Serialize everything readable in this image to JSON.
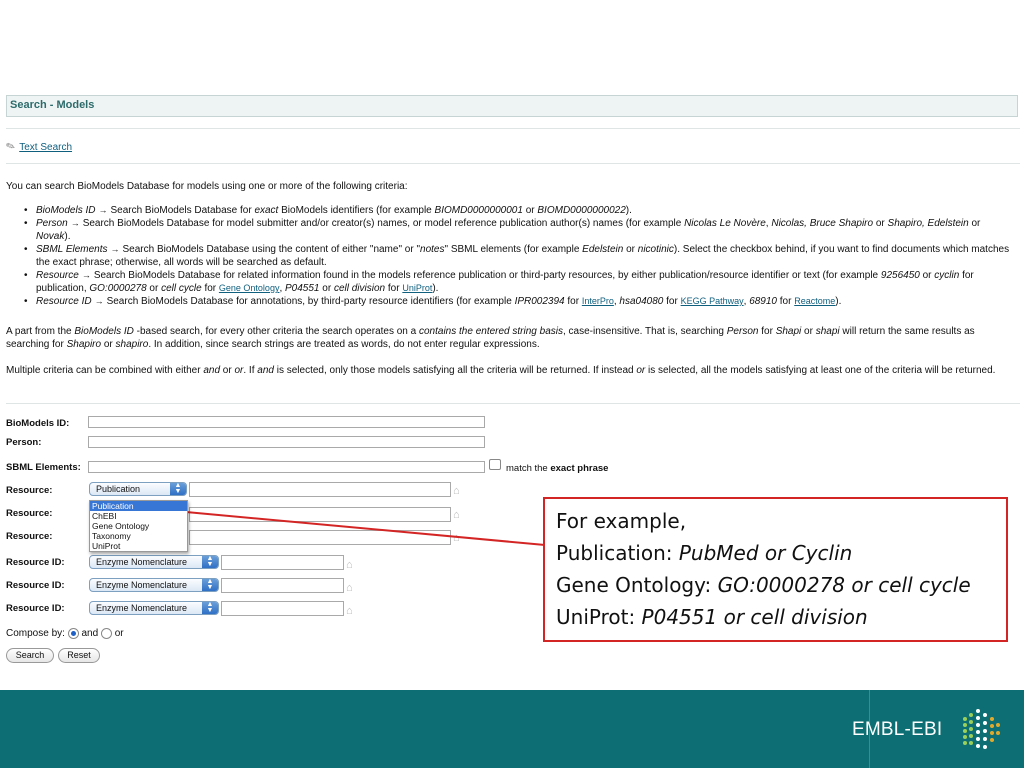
{
  "header": {
    "title": "Search - Models"
  },
  "text_search": {
    "label": "Text Search"
  },
  "intro": "You can search BioModels Database for models using one or more of the following criteria:",
  "criteria": [
    {
      "name": "BioModels ID",
      "arrow": "→"
    },
    {
      "name": "Person",
      "arrow": "→"
    },
    {
      "name": "SBML Elements",
      "arrow": "→"
    },
    {
      "name": "Resource",
      "arrow": "→"
    },
    {
      "name": "Resource ID",
      "arrow": "→"
    }
  ],
  "text": {
    "c1a": "Search BioModels Database for ",
    "c1b": "exact",
    "c1c": " BioModels identifiers (for example ",
    "c1d": "BIOMD0000000001",
    "c1e": " or ",
    "c1f": "BIOMD0000000022",
    "c1g": ").",
    "c2a": "Search BioModels Database for model submitter and/or creator(s) names, or model reference publication author(s) names (for example ",
    "c2b": "Nicolas Le Novère",
    "c2c": ", ",
    "c2d": "Nicolas, Bruce Shapiro",
    "c2e": " or ",
    "c2f": "Shapiro, Edelstein",
    "c2g": " or ",
    "c2h": "Novak",
    "c2i": ").",
    "c3a": "Search BioModels Database using the content of either \"name\" or \"",
    "c3b": "notes",
    "c3c": "\" SBML elements (for example ",
    "c3d": "Edelstein",
    "c3e": " or ",
    "c3f": "nicotinic",
    "c3g": "). Select the checkbox behind, if you want to find documents which matches the exact phrase; otherwise, all words will be searched as default.",
    "c4a": "Search BioModels Database for related information found in the models reference publication or third-party resources, by either publication/resource identifier or text (for example ",
    "c4b": "9256450",
    "c4c": " or ",
    "c4d": "cyclin",
    "c4e": " for publication, ",
    "c4f": "GO:0000278",
    "c4g": " or ",
    "c4h": "cell cycle",
    "c4i": " for ",
    "c4j": "Gene Ontology",
    "c4k": ", ",
    "c4l": "P04551",
    "c4m": " or ",
    "c4n": "cell division",
    "c4o": " for ",
    "c4p": "UniProt",
    "c4q": ").",
    "c5a": "Search BioModels Database for annotations, by third-party resource identifiers (for example ",
    "c5b": "IPR002394",
    "c5c": " for ",
    "c5d": "InterPro",
    "c5e": ", ",
    "c5f": "hsa04080",
    "c5g": " for ",
    "c5h": "KEGG Pathway",
    "c5i": ", ",
    "c5j": "68910",
    "c5k": " for ",
    "c5l": "Reactome",
    "c5m": ").",
    "p1a": "A part from the ",
    "p1b": "BioModels ID",
    "p1c": " -based search, for every other criteria the search operates on a ",
    "p1d": "contains the entered string basis",
    "p1e": ", case-insensitive. That is, searching ",
    "p1f": "Person",
    "p1g": " for ",
    "p1h": "Shapi",
    "p1i": " or ",
    "p1j": "shapi",
    "p1k": " will return the same results as searching for ",
    "p1l": "Shapiro",
    "p1m": " or ",
    "p1n": "shapiro",
    "p1o": ". In addition, since search strings are treated as words, do not enter regular expressions.",
    "p2a": "Multiple criteria can be combined with either ",
    "p2b": "and",
    "p2c": " or ",
    "p2d": "or",
    "p2e": ". If ",
    "p2f": "and",
    "p2g": " is selected, only those models satisfying all the criteria will be returned. If instead ",
    "p2h": "or",
    "p2i": " is selected, all the models satisfying at least one of the criteria will be returned."
  },
  "form": {
    "labels": {
      "biomodels_id": "BioModels ID:",
      "person": "Person:",
      "sbml": "SBML Elements:",
      "resource": "Resource:",
      "resource_id": "Resource ID:"
    },
    "biomodels_id_value": "",
    "person_value": "",
    "sbml_value": "",
    "match_label_a": "match the ",
    "match_label_b": "exact phrase",
    "resource_selected": "Publication",
    "resource_options": [
      "Publication",
      "ChEBI",
      "Gene Ontology",
      "Taxonomy",
      "UniProt"
    ],
    "resource_id_selected": "Enzyme Nomenclature",
    "compose_label": "Compose by:",
    "and_label": "and",
    "or_label": "or",
    "search_button": "Search",
    "reset_button": "Reset"
  },
  "callout": {
    "line1": "For example,",
    "l2_label": "Publication: ",
    "l2_value": "PubMed or Cyclin",
    "l3_label": "Gene Ontology: ",
    "l3_value": "GO:0000278 or cell cycle",
    "l4_label": "UniProt: ",
    "l4_value": "P04551 or cell division"
  },
  "footer": {
    "brand": "EMBL-EBI"
  },
  "colors": {
    "footer": "#0d6f73",
    "header_text": "#2d6b6b",
    "callout_border": "#d42525",
    "select_highlight": "#3876d6"
  },
  "icons": [
    "pencil-icon",
    "home-icon",
    "select-arrows-icon",
    "ebi-logo-icon"
  ]
}
